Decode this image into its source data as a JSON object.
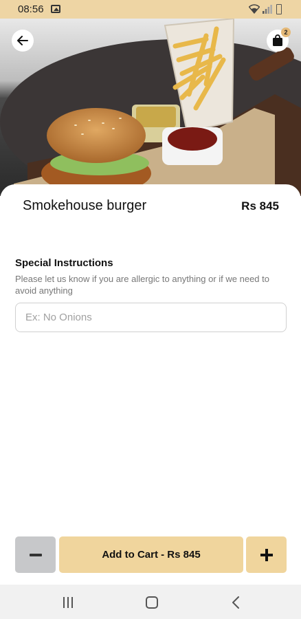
{
  "status_bar": {
    "time": "08:56"
  },
  "header": {
    "cart_count": "2"
  },
  "item": {
    "name": "Smokehouse burger",
    "price": "Rs 845"
  },
  "instructions": {
    "title": "Special Instructions",
    "description": "Please let us know if you are allergic to anything or if we need to avoid anything",
    "placeholder": "Ex: No Onions",
    "value": ""
  },
  "footer": {
    "add_label": "Add to Cart - Rs 845"
  },
  "colors": {
    "accent": "#f0d59d",
    "status_bar": "#eed5a4",
    "minus_button": "#c7c8ca",
    "badge": "#e5b978"
  },
  "icons": [
    "back-arrow-icon",
    "shopping-bag-icon",
    "minus-icon",
    "plus-icon",
    "wifi-icon",
    "signal-icon",
    "battery-icon",
    "gallery-icon",
    "recents-icon",
    "home-icon",
    "nav-back-icon"
  ]
}
